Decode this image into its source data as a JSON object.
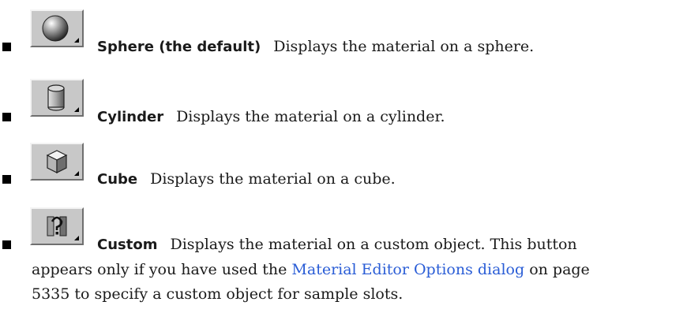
{
  "items": [
    {
      "icon": "sphere-icon",
      "term": "Sphere (the default)",
      "description": "Displays the material on a sphere."
    },
    {
      "icon": "cylinder-icon",
      "term": "Cylinder",
      "description": "Displays the material on a cylinder."
    },
    {
      "icon": "cube-icon",
      "term": "Cube",
      "description": "Displays the material on a cube."
    },
    {
      "icon": "custom-object-icon",
      "term": "Custom",
      "description": "Displays the material on a custom object. This button",
      "line2_before": "appears only if you have used the",
      "link": "Material Editor Options dialog",
      "line2_after": "on page",
      "line3": "5335 to specify a custom object for sample slots."
    }
  ],
  "colors": {
    "link": "#2a5dd6",
    "button_face": "#c8c8c8"
  }
}
